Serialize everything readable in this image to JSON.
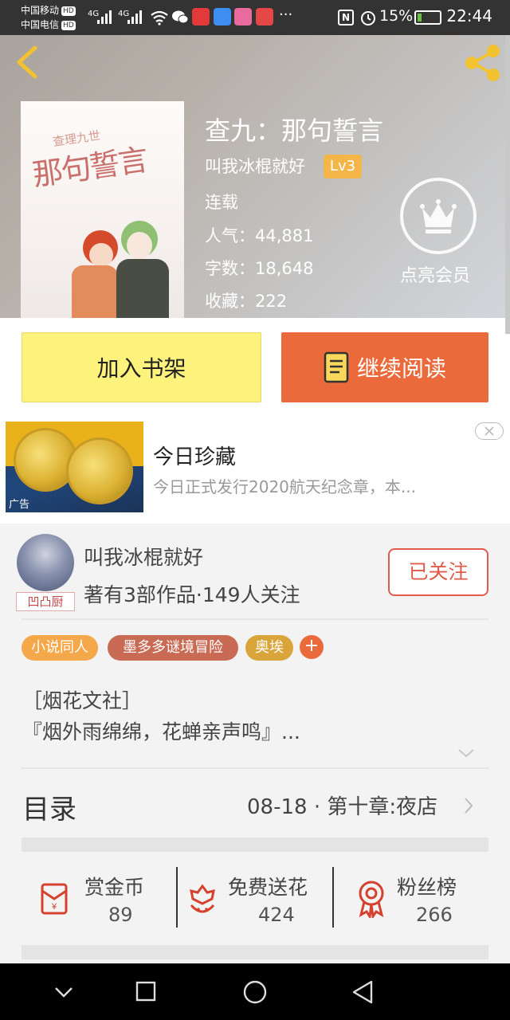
{
  "status_bar": {
    "carrier1": "中国移动",
    "carrier2": "中国电信",
    "hd": "HD",
    "net1": "4G",
    "net2": "4G",
    "battery_pct": "15%",
    "time": "22:44"
  },
  "book": {
    "title": "查九：那句誓言",
    "author": "叫我冰棍就好",
    "level": "Lv3",
    "status": "连载",
    "popularity": "人气：44,881",
    "words": "字数：18,648",
    "favorites": "收藏：222",
    "vip_label": "点亮会员",
    "cover_small": "查理九世",
    "cover_title": "那句誓言"
  },
  "actions": {
    "add_shelf": "加入书架",
    "continue_read": "继续阅读"
  },
  "ad": {
    "title": "今日珍藏",
    "desc": "今日正式发行2020航天纪念章，本...",
    "tag": "广告"
  },
  "author_card": {
    "name": "叫我冰棍就好",
    "works": "著有3部作品·149人关注",
    "badge": "凹凸厨",
    "follow": "已关注"
  },
  "tags": [
    {
      "label": "小说同人",
      "color": "#f4a84a"
    },
    {
      "label": "墨多多谜境冒险",
      "color": "#c96b54"
    },
    {
      "label": "奥埃",
      "color": "#d9a53b"
    }
  ],
  "tag_add": "+",
  "description": {
    "line1": "［烟花文社］",
    "line2": "『烟外雨绵绵，花蝉亲声鸣』..."
  },
  "toc": {
    "label": "目录",
    "latest": "08-18 · 第十章:夜店"
  },
  "stats": [
    {
      "label": "赏金币",
      "value": "89",
      "icon": "red-envelope-icon"
    },
    {
      "label": "免费送花",
      "value": "424",
      "icon": "flower-icon"
    },
    {
      "label": "粉丝榜",
      "value": "266",
      "icon": "medal-icon"
    }
  ],
  "colors": {
    "accent": "#ea6a3b",
    "shelf_yellow": "#fdf27b",
    "icon_red": "#d5412f",
    "lv_badge": "#f4b648"
  }
}
